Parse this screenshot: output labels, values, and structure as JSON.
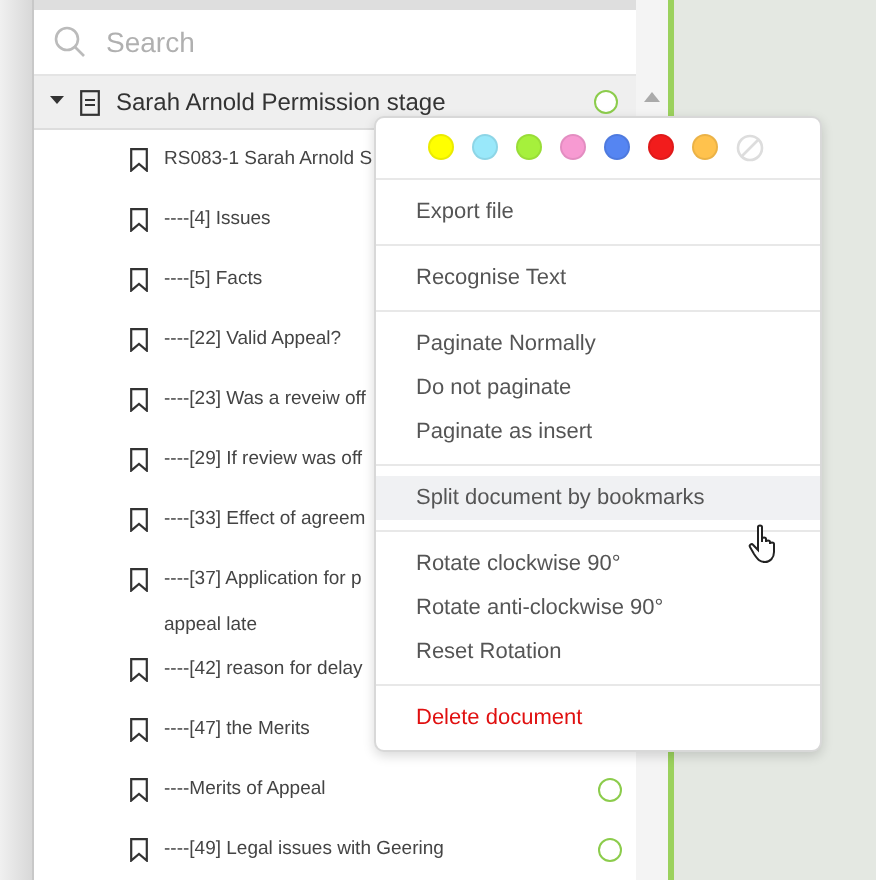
{
  "search": {
    "placeholder": "Search"
  },
  "document": {
    "title": "Sarah Arnold Permission stage",
    "expanded": true,
    "node": true
  },
  "bookmarks": [
    {
      "lines": [
        "RS083-1 Sarah Arnold S"
      ],
      "node": false
    },
    {
      "lines": [
        "----[4] Issues"
      ],
      "node": false
    },
    {
      "lines": [
        "----[5] Facts"
      ],
      "node": false
    },
    {
      "lines": [
        "----[22] Valid Appeal?"
      ],
      "node": false
    },
    {
      "lines": [
        "----[23] Was a reveiw off"
      ],
      "node": false
    },
    {
      "lines": [
        "----[29] If review was off"
      ],
      "node": false
    },
    {
      "lines": [
        "----[33] Effect of agreem"
      ],
      "node": false
    },
    {
      "lines": [
        "----[37] Application for p",
        "appeal late"
      ],
      "node": false
    },
    {
      "lines": [
        "----[42] reason for delay"
      ],
      "node": false
    },
    {
      "lines": [
        "----[47] the Merits"
      ],
      "node": false
    },
    {
      "lines": [
        "----Merits of Appeal"
      ],
      "node": true
    },
    {
      "lines": [
        "----[49] Legal issues with Geering"
      ],
      "node": true
    }
  ],
  "context_menu": {
    "swatches": [
      {
        "color": "#ffff00"
      },
      {
        "color": "#99e8fa"
      },
      {
        "color": "#a6f03c"
      },
      {
        "color": "#f79ad2"
      },
      {
        "color": "#5585f2"
      },
      {
        "color": "#f21c1c"
      },
      {
        "color": "#ffc24d"
      },
      {
        "kind": "none"
      }
    ],
    "sections": [
      [
        {
          "label": "Export file",
          "kind": "normal",
          "selected": false
        }
      ],
      [
        {
          "label": "Recognise Text",
          "kind": "normal",
          "selected": false
        }
      ],
      [
        {
          "label": "Paginate Normally",
          "kind": "normal",
          "selected": false
        },
        {
          "label": "Do not paginate",
          "kind": "normal",
          "selected": false
        },
        {
          "label": "Paginate as insert",
          "kind": "normal",
          "selected": false
        }
      ],
      [
        {
          "label": "Split document by bookmarks",
          "kind": "normal",
          "selected": true
        }
      ],
      [
        {
          "label": "Rotate clockwise 90°",
          "kind": "normal",
          "selected": false
        },
        {
          "label": "Rotate anti-clockwise 90°",
          "kind": "normal",
          "selected": false
        },
        {
          "label": "Reset Rotation",
          "kind": "normal",
          "selected": false
        }
      ],
      [
        {
          "label": "Delete document",
          "kind": "danger",
          "selected": false
        }
      ]
    ]
  }
}
